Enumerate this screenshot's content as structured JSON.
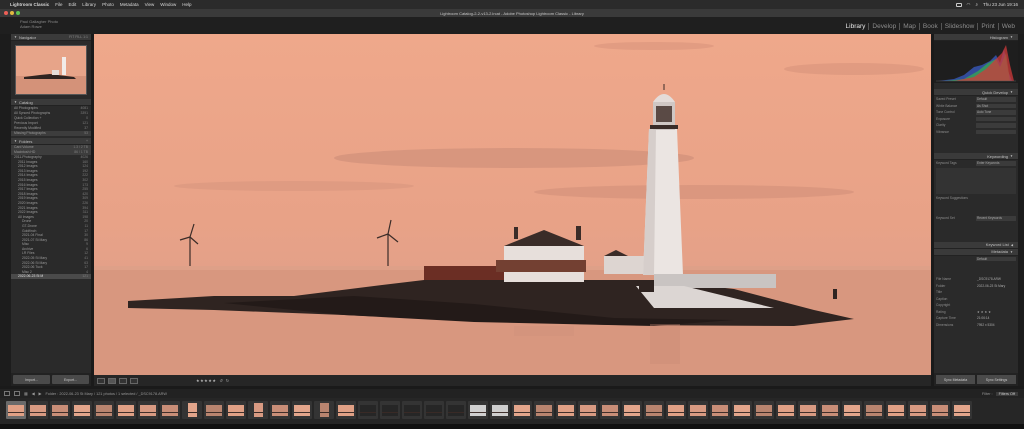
{
  "menubar": {
    "app": "Lightroom Classic",
    "items": [
      "File",
      "Edit",
      "Library",
      "Photo",
      "Metadata",
      "View",
      "Window",
      "Help"
    ],
    "clock": "Thu 23 Jun  19:16"
  },
  "window": {
    "title": "Lightroom Catalog-2-2-v13-2.lrcat - Adobe Photoshop Lightroom Classic - Library"
  },
  "identity": {
    "line1": "Paul Gallagher Photo",
    "line2": "Adam Rowe"
  },
  "modules": [
    {
      "label": "Library",
      "active": true
    },
    {
      "label": "Develop",
      "active": false
    },
    {
      "label": "Map",
      "active": false
    },
    {
      "label": "Book",
      "active": false
    },
    {
      "label": "Slideshow",
      "active": false
    },
    {
      "label": "Print",
      "active": false
    },
    {
      "label": "Web",
      "active": false
    }
  ],
  "left": {
    "navigator": {
      "title": "Navigator",
      "zoom": "FIT  FILL  1:1"
    },
    "catalog": {
      "title": "Catalog",
      "rows": [
        {
          "label": "All Photographs",
          "count": "4081"
        },
        {
          "label": "All Synced Photographs",
          "count": "3391"
        },
        {
          "label": "Quick Collection +",
          "count": "0"
        },
        {
          "label": "Previous Import",
          "count": "121"
        },
        {
          "label": "Recently Modified",
          "count": "37"
        },
        {
          "label": "Missing Photographs",
          "count": "53"
        }
      ]
    },
    "folders": {
      "title": "Folders",
      "volumes": [
        {
          "label": "Card Volume",
          "count": "1.3 / 2 TB"
        },
        {
          "label": "Macintosh HD",
          "count": "86 / 1 TB"
        }
      ],
      "tree": [
        {
          "label": "2011-Photography",
          "count": "4026"
        },
        {
          "label": "2011 Images",
          "count": "160"
        },
        {
          "label": "2012 Images",
          "count": "124"
        },
        {
          "label": "2013 Images",
          "count": "192"
        },
        {
          "label": "2014 Images",
          "count": "222"
        },
        {
          "label": "2015 Images",
          "count": "302"
        },
        {
          "label": "2016 Images",
          "count": "173"
        },
        {
          "label": "2017 Images",
          "count": "255"
        },
        {
          "label": "2018 Images",
          "count": "420"
        },
        {
          "label": "2019 Images",
          "count": "309"
        },
        {
          "label": "2020 Images",
          "count": "226"
        },
        {
          "label": "2021 Images",
          "count": "394"
        },
        {
          "label": "2022 Images",
          "count": "311"
        },
        {
          "label": "All Images",
          "count": "198"
        },
        {
          "label": "Drone",
          "count": "20"
        },
        {
          "label": "GT-Drone",
          "count": "11"
        },
        {
          "label": "Goldfinch",
          "count": "17"
        },
        {
          "label": "2021-04 Final",
          "count": "30"
        },
        {
          "label": "2021-07 St Mary",
          "count": "86"
        },
        {
          "label": "Misc",
          "count": "9"
        },
        {
          "label": "Archive",
          "count": "6"
        },
        {
          "label": "LR Files",
          "count": "12"
        },
        {
          "label": "2022-05 St Mary",
          "count": "41"
        },
        {
          "label": "2022-06 St Mary",
          "count": "63"
        },
        {
          "label": "2022-06 Tuck",
          "count": "17"
        },
        {
          "label": "Misc 2",
          "count": "4"
        },
        {
          "label": "2022-06-23 St M",
          "count": "121"
        }
      ]
    },
    "footer": {
      "import": "Import...",
      "export": "Export..."
    }
  },
  "toolbar": {
    "stars": "★★★★★"
  },
  "right": {
    "histogram_title": "Histogram",
    "quick_develop": {
      "title": "Quick Develop",
      "rows": [
        {
          "label": "Saved Preset",
          "value": "Default"
        },
        {
          "label": "White Balance",
          "value": "As Shot"
        },
        {
          "label": "Tone Control",
          "value": "Auto Tone"
        },
        {
          "label": "Exposure",
          "value": ""
        },
        {
          "label": "Clarity",
          "value": ""
        },
        {
          "label": "Vibrance",
          "value": ""
        }
      ]
    },
    "keywording": {
      "title": "Keywording",
      "tags_label": "Keyword Tags",
      "tags_value": "Enter Keywords",
      "suggestions": "Keyword Suggestions",
      "set_label": "Keyword Set",
      "set_value": "Recent Keywords"
    },
    "keyword_list": {
      "title": "Keyword List"
    },
    "metadata": {
      "title": "Metadata",
      "preset": "Default",
      "rows": [
        {
          "label": "File Name",
          "value": "_DSC9178.ARW"
        },
        {
          "label": "Folder",
          "value": "2022-06-23 St Mary"
        },
        {
          "label": "Title",
          "value": ""
        },
        {
          "label": "Caption",
          "value": ""
        },
        {
          "label": "Copyright",
          "value": ""
        },
        {
          "label": "Rating",
          "value": "★ ★ ★ ★"
        },
        {
          "label": "Capture Time",
          "value": "21:06:14"
        },
        {
          "label": "Dimensions",
          "value": "7952 x 5304"
        }
      ]
    },
    "footer": {
      "sync": "Sync Metadata",
      "settings": "Sync Settings"
    }
  },
  "filmbar": {
    "path": "Folder : 2022-06-23 St Mary / 121 photos / 1 selected / _DSC9178.ARW",
    "filter_label": "Filter :",
    "filter_value": "Filters Off"
  },
  "filmstrip": {
    "count": 44,
    "selected_index": 0
  },
  "colors": {
    "sky": "#e7a489",
    "sea": "#d99a80",
    "lighthouse": "#ece6e3",
    "land": "#2f2421"
  }
}
